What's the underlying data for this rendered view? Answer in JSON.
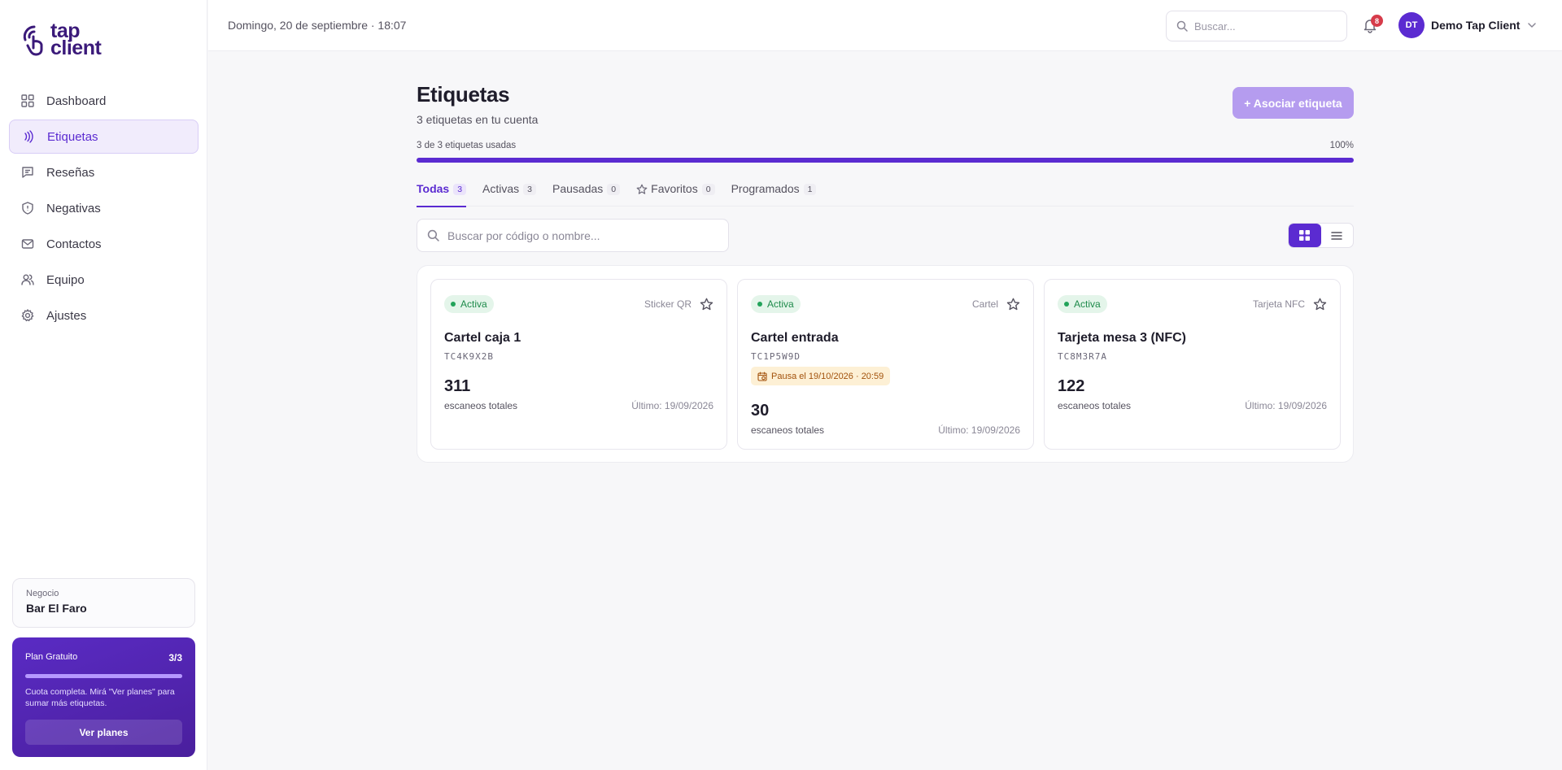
{
  "brand": {
    "line1": "tap",
    "line2": "client"
  },
  "sidebar": {
    "items": [
      {
        "label": "Dashboard",
        "icon": "dashboard-icon"
      },
      {
        "label": "Etiquetas",
        "icon": "nfc-signal-icon"
      },
      {
        "label": "Reseñas",
        "icon": "message-icon"
      },
      {
        "label": "Negativas",
        "icon": "shield-icon"
      },
      {
        "label": "Contactos",
        "icon": "mail-icon"
      },
      {
        "label": "Equipo",
        "icon": "users-icon"
      },
      {
        "label": "Ajustes",
        "icon": "gear-icon"
      }
    ],
    "active_index": 1
  },
  "business": {
    "label": "Negocio",
    "name": "Bar El Faro"
  },
  "plan": {
    "name": "Plan Gratuito",
    "count": "3/3",
    "usage_fraction": 1.0,
    "message": "Cuota completa. Mirá \"Ver planes\" para sumar más etiquetas.",
    "button_label": "Ver planes"
  },
  "header": {
    "date": "Domingo, 20 de septiembre · 18:07",
    "search_placeholder": "Buscar...",
    "notifications_count": "8",
    "user_initials": "DT",
    "user_name": "Demo Tap Client"
  },
  "page": {
    "title": "Etiquetas",
    "subtitle": "3 etiquetas en tu cuenta",
    "add_button_label": "+ Asociar etiqueta",
    "usage_label": "3 de 3 etiquetas usadas",
    "usage_percent_label": "100%",
    "usage_fraction": 1.0
  },
  "tabs": [
    {
      "label": "Todas",
      "count": "3"
    },
    {
      "label": "Activas",
      "count": "3"
    },
    {
      "label": "Pausadas",
      "count": "0"
    },
    {
      "label": "Favoritos",
      "count": "0"
    },
    {
      "label": "Programados",
      "count": "1"
    }
  ],
  "filter": {
    "search_placeholder": "Buscar por código o nombre..."
  },
  "colors": {
    "accent": "#5b2bd1",
    "status_active": "#1d8a4a",
    "pause_tag": "#a2510b"
  },
  "cards": [
    {
      "status": "Activa",
      "type": "Sticker QR",
      "name": "Cartel caja 1",
      "code": "TC4K9X2B",
      "scans": "311",
      "scans_label": "escaneos totales",
      "last": "Último: 19/09/2026"
    },
    {
      "status": "Activa",
      "type": "Cartel",
      "name": "Cartel entrada",
      "code": "TC1P5W9D",
      "pause_tag": "Pausa el 19/10/2026 · 20:59",
      "scans": "30",
      "scans_label": "escaneos totales",
      "last": "Último: 19/09/2026"
    },
    {
      "status": "Activa",
      "type": "Tarjeta NFC",
      "name": "Tarjeta mesa 3 (NFC)",
      "code": "TC8M3R7A",
      "scans": "122",
      "scans_label": "escaneos totales",
      "last": "Último: 19/09/2026"
    }
  ]
}
